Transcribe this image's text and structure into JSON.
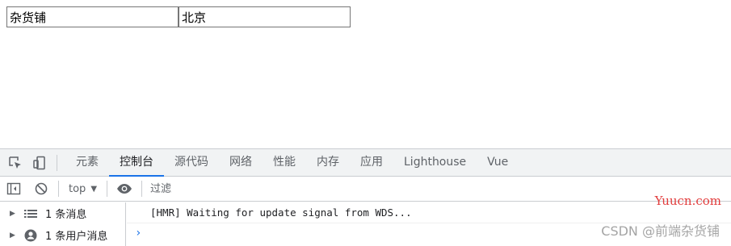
{
  "page": {
    "input1_value": "杂货铺",
    "input2_value": "北京"
  },
  "devtools": {
    "tabs": [
      {
        "label": "元素"
      },
      {
        "label": "控制台"
      },
      {
        "label": "源代码"
      },
      {
        "label": "网络"
      },
      {
        "label": "性能"
      },
      {
        "label": "内存"
      },
      {
        "label": "应用"
      },
      {
        "label": "Lighthouse"
      },
      {
        "label": "Vue"
      }
    ],
    "active_tab": "控制台",
    "icons": {
      "inspect": "inspect-element-icon",
      "device": "device-toolbar-icon",
      "sidebar_toggle": "sidebar-toggle-icon",
      "clear": "clear-console-icon",
      "eye": "live-expression-icon"
    },
    "context": "top",
    "filter_placeholder": "过滤",
    "sidebar": [
      {
        "label": "1 条消息"
      },
      {
        "label": "1 条用户消息"
      }
    ],
    "log_line": "[HMR] Waiting for update signal from WDS...",
    "accent_color": "#1a73e8"
  },
  "watermarks": {
    "site": "Yuucn.com",
    "csdn": "CSDN @前端杂货铺"
  }
}
